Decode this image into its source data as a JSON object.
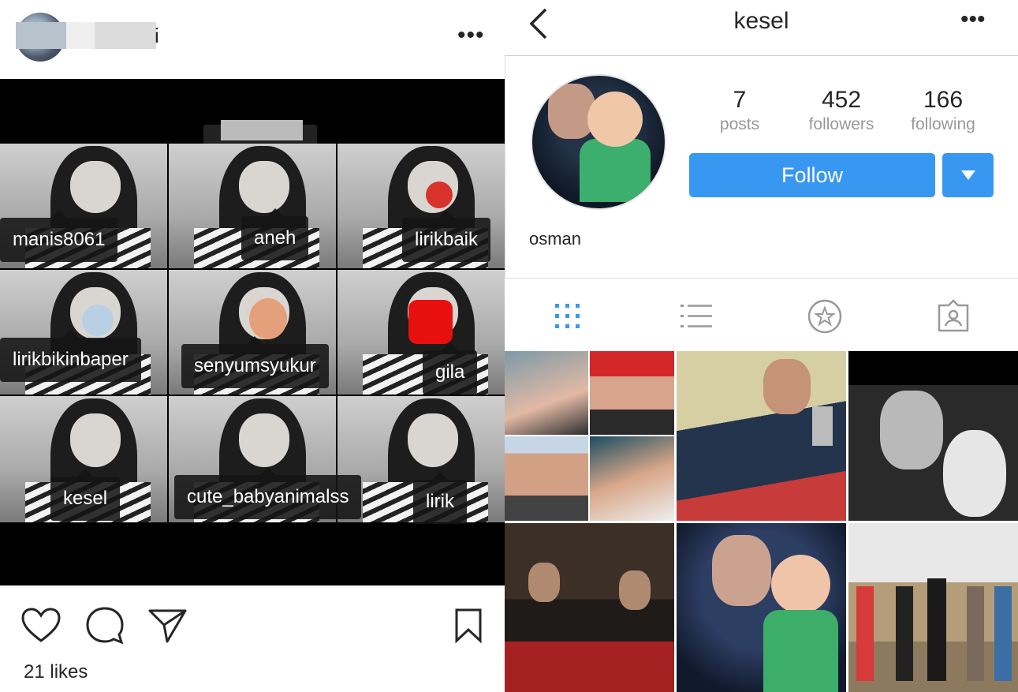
{
  "left": {
    "header": {
      "username_fragment": "i",
      "more": "•••"
    },
    "tags": [
      "manis8061",
      "aneh",
      "lirikbaik",
      "lirikbikinbaper",
      "senyumsyukur",
      "gila",
      "kesel",
      "cute_babyanimalss",
      "lirik"
    ],
    "likes": "21 likes"
  },
  "right": {
    "header": {
      "title": "kesel",
      "more": "•••"
    },
    "stats": {
      "posts": {
        "value": "7",
        "label": "posts"
      },
      "followers": {
        "value": "452",
        "label": "followers"
      },
      "following": {
        "value": "166",
        "label": "following"
      }
    },
    "follow_label": "Follow",
    "full_name": "osman",
    "tabs": [
      "grid-view",
      "list-view",
      "saved-starred",
      "tagged-photos"
    ]
  },
  "colors": {
    "accent": "#3897f0",
    "muted": "#999999",
    "text": "#262626"
  }
}
